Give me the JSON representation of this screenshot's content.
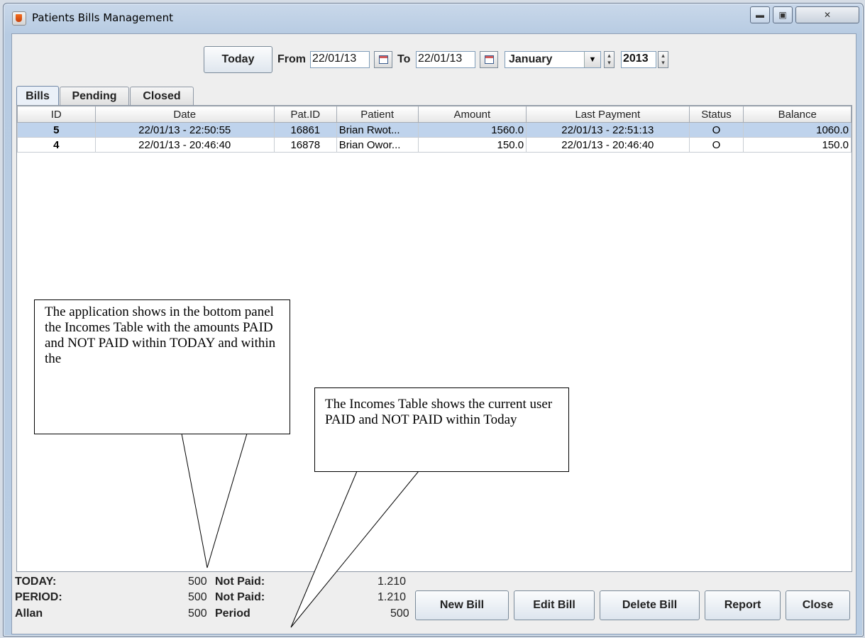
{
  "window": {
    "title": "Patients Bills Management"
  },
  "toolbar": {
    "today_label": "Today",
    "from_label": "From",
    "from_value": "22/01/13",
    "to_label": "To",
    "to_value": "22/01/13",
    "month": "January",
    "year": "2013"
  },
  "tabs": [
    "Bills",
    "Pending",
    "Closed"
  ],
  "table": {
    "columns": [
      "ID",
      "Date",
      "Pat.ID",
      "Patient",
      "Amount",
      "Last Payment",
      "Status",
      "Balance"
    ],
    "rows": [
      [
        "5",
        "22/01/13 - 22:50:55",
        "16861",
        "Brian Rwot...",
        "1560.0",
        "22/01/13 - 22:51:13",
        "O",
        "1060.0"
      ],
      [
        "4",
        "22/01/13 - 20:46:40",
        "16878",
        "Brian Owor...",
        "150.0",
        "22/01/13 - 20:46:40",
        "O",
        "150.0"
      ]
    ]
  },
  "callouts": {
    "left": "The application shows in the bottom panel the Incomes Table with the amounts PAID and NOT PAID within TODAY and within the",
    "right": "The Incomes Table shows the current user PAID and NOT PAID within Today"
  },
  "incomes": {
    "rows": [
      {
        "label": "TODAY:",
        "value": "500",
        "label2": "Not Paid:",
        "value2": "1.210"
      },
      {
        "label": "PERIOD:",
        "value": "500",
        "label2": "Not Paid:",
        "value2": "1.210"
      },
      {
        "label": "Allan",
        "value": "500",
        "label2": "Period",
        "value2": "500"
      }
    ]
  },
  "buttons": {
    "new_bill": "New Bill",
    "edit_bill": "Edit Bill",
    "delete_bill": "Delete Bill",
    "report": "Report",
    "close": "Close"
  }
}
